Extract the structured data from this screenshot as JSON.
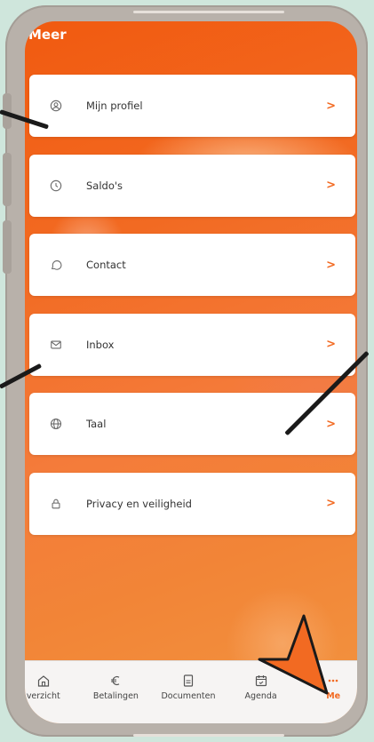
{
  "screen": {
    "title": "Meer"
  },
  "menu": [
    {
      "label": "Mijn profiel",
      "icon": "user-circle-icon"
    },
    {
      "label": "Saldo's",
      "icon": "clock-icon"
    },
    {
      "label": "Contact",
      "icon": "chat-bubble-icon"
    },
    {
      "label": "Inbox",
      "icon": "mail-icon"
    },
    {
      "label": "Taal",
      "icon": "globe-icon"
    },
    {
      "label": "Privacy en veiligheid",
      "icon": "lock-icon"
    }
  ],
  "chevron": ">",
  "bottom_nav": [
    {
      "label": "verzicht",
      "icon": "home-icon"
    },
    {
      "label": "Betalingen",
      "icon": "euro-icon"
    },
    {
      "label": "Documenten",
      "icon": "document-icon"
    },
    {
      "label": "Agenda",
      "icon": "calendar-icon"
    },
    {
      "label": "Me",
      "icon": "more-dots-icon",
      "active": true
    }
  ],
  "colors": {
    "accent": "#f26a22",
    "background": "#cfe6dc",
    "annotation_arrow": "#f26a22"
  }
}
